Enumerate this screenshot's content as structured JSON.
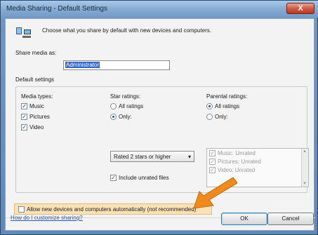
{
  "window": {
    "title": "Media Sharing - Default Settings",
    "close_label": "X"
  },
  "header": {
    "text": "Choose what you share by default with new devices and computers."
  },
  "share_name": {
    "label": "Share media as:",
    "value": "Administrator"
  },
  "default_settings": {
    "label": "Default settings",
    "media_types": {
      "label": "Media types:",
      "items": [
        {
          "label": "Music",
          "checked": true
        },
        {
          "label": "Pictures",
          "checked": true
        },
        {
          "label": "Video",
          "checked": true
        }
      ]
    },
    "star_ratings": {
      "label": "Star ratings:",
      "all_label": "All ratings",
      "only_label": "Only:",
      "selected": "Only:",
      "dropdown_value": "Rated 2 stars or higher",
      "include_unrated_label": "Include unrated files",
      "include_unrated_checked": true
    },
    "parental_ratings": {
      "label": "Parental ratings:",
      "all_label": "All ratings",
      "only_label": "Only:",
      "selected": "All ratings",
      "list_items": [
        {
          "label": "Music: Unrated",
          "checked": true
        },
        {
          "label": "Pictures: Unrated",
          "checked": true
        },
        {
          "label": "Video: Unrated",
          "checked": true
        }
      ]
    }
  },
  "allow_devices": {
    "label": "Allow new devices and computers automatically (not recommended)",
    "checked": false
  },
  "footer": {
    "help_link": "How do I customize sharing?",
    "ok_label": "OK",
    "cancel_label": "Cancel"
  },
  "colors": {
    "highlight": "#fbe2b6",
    "arrow": "#f08a1c",
    "link": "#2a57b5"
  }
}
